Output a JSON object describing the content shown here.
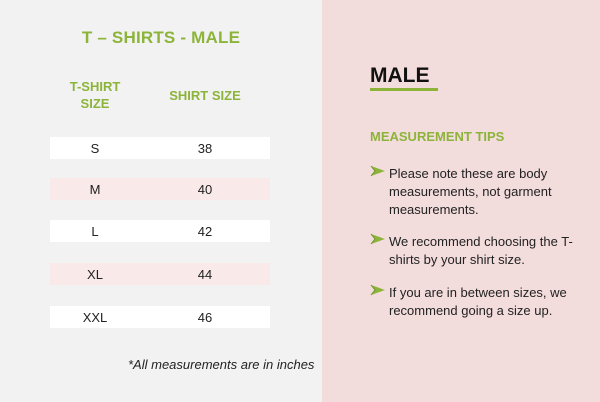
{
  "left": {
    "title": "T – SHIRTS - MALE",
    "col_size_line1": "T-SHIRT",
    "col_size_line2": "SIZE",
    "col_shirt": "SHIRT SIZE",
    "rows": [
      {
        "size": "S",
        "shirt": "38"
      },
      {
        "size": "M",
        "shirt": "40"
      },
      {
        "size": "L",
        "shirt": "42"
      },
      {
        "size": "XL",
        "shirt": "44"
      },
      {
        "size": "XXL",
        "shirt": "46"
      }
    ],
    "note": "*All measurements are in inches"
  },
  "right": {
    "title": "MALE",
    "tips_heading": "MEASUREMENT TIPS",
    "tips": [
      "Please note these are body measurements, not garment measurements.",
      "We recommend choosing the T-shirts by your shirt size.",
      "If you are in between sizes, we recommend going a size up."
    ]
  },
  "colors": {
    "accent": "#8db43a",
    "left_bg": "#f2f2f2",
    "right_bg": "#f3dcdc",
    "row_pink": "#f9e9e9"
  },
  "icons": {
    "tip_bullet": "check-arrow-icon"
  }
}
